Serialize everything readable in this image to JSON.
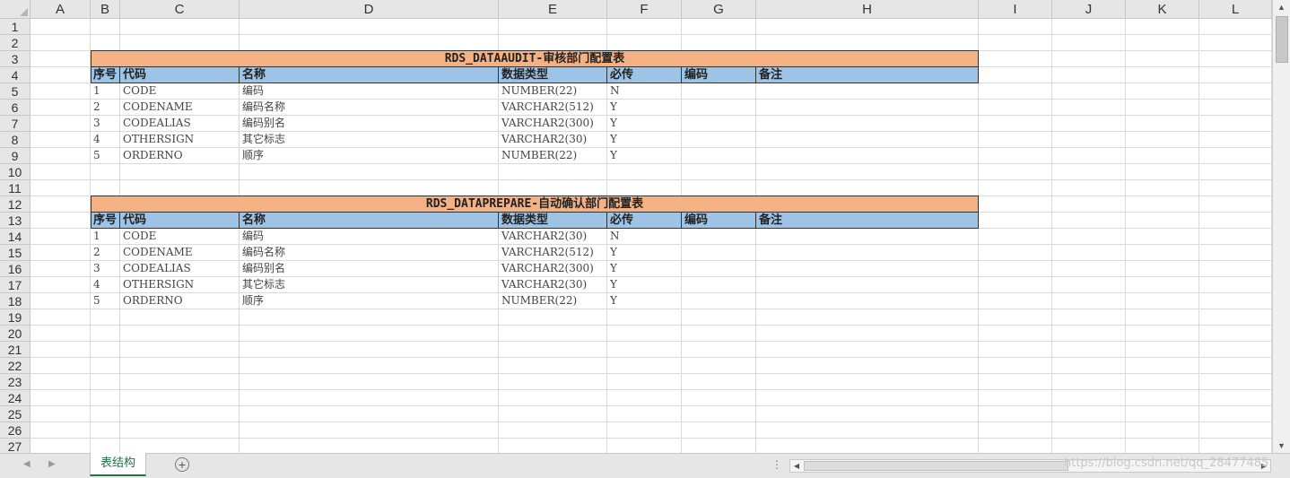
{
  "columns": [
    "A",
    "B",
    "C",
    "D",
    "E",
    "F",
    "G",
    "H",
    "I",
    "J",
    "K",
    "L"
  ],
  "rows": [
    "1",
    "2",
    "3",
    "4",
    "5",
    "6",
    "7",
    "8",
    "9",
    "10",
    "11",
    "12",
    "13",
    "14",
    "15",
    "16",
    "17",
    "18",
    "19",
    "20",
    "21",
    "22",
    "23",
    "24",
    "25",
    "26",
    "27"
  ],
  "tables": [
    {
      "title": "RDS_DATAAUDIT-审核部门配置表",
      "headers": [
        "序号",
        "代码",
        "名称",
        "数据类型",
        "必传",
        "编码",
        "备注"
      ],
      "records": [
        [
          "1",
          "CODE",
          "编码",
          "NUMBER(22)",
          "N"
        ],
        [
          "2",
          "CODENAME",
          "编码名称",
          "VARCHAR2(512)",
          "Y"
        ],
        [
          "3",
          "CODEALIAS",
          "编码别名",
          "VARCHAR2(300)",
          "Y"
        ],
        [
          "4",
          "OTHERSIGN",
          "其它标志",
          "VARCHAR2(30)",
          "Y"
        ],
        [
          "5",
          "ORDERNO",
          "顺序",
          "NUMBER(22)",
          "Y"
        ]
      ]
    },
    {
      "title": "RDS_DATAPREPARE-自动确认部门配置表",
      "headers": [
        "序号",
        "代码",
        "名称",
        "数据类型",
        "必传",
        "编码",
        "备注"
      ],
      "records": [
        [
          "1",
          "CODE",
          "编码",
          "VARCHAR2(30)",
          "N"
        ],
        [
          "2",
          "CODENAME",
          "编码名称",
          "VARCHAR2(512)",
          "Y"
        ],
        [
          "3",
          "CODEALIAS",
          "编码别名",
          "VARCHAR2(300)",
          "Y"
        ],
        [
          "4",
          "OTHERSIGN",
          "其它标志",
          "VARCHAR2(30)",
          "Y"
        ],
        [
          "5",
          "ORDERNO",
          "顺序",
          "NUMBER(22)",
          "Y"
        ]
      ]
    }
  ],
  "sheet_tab": "表结构",
  "add_sheet_label": "+",
  "watermark": "https://blog.csdn.net/qq_28477485",
  "colors": {
    "title_fill": "#f4b183",
    "header_fill": "#9dc3e6",
    "active_tab": "#217346"
  }
}
